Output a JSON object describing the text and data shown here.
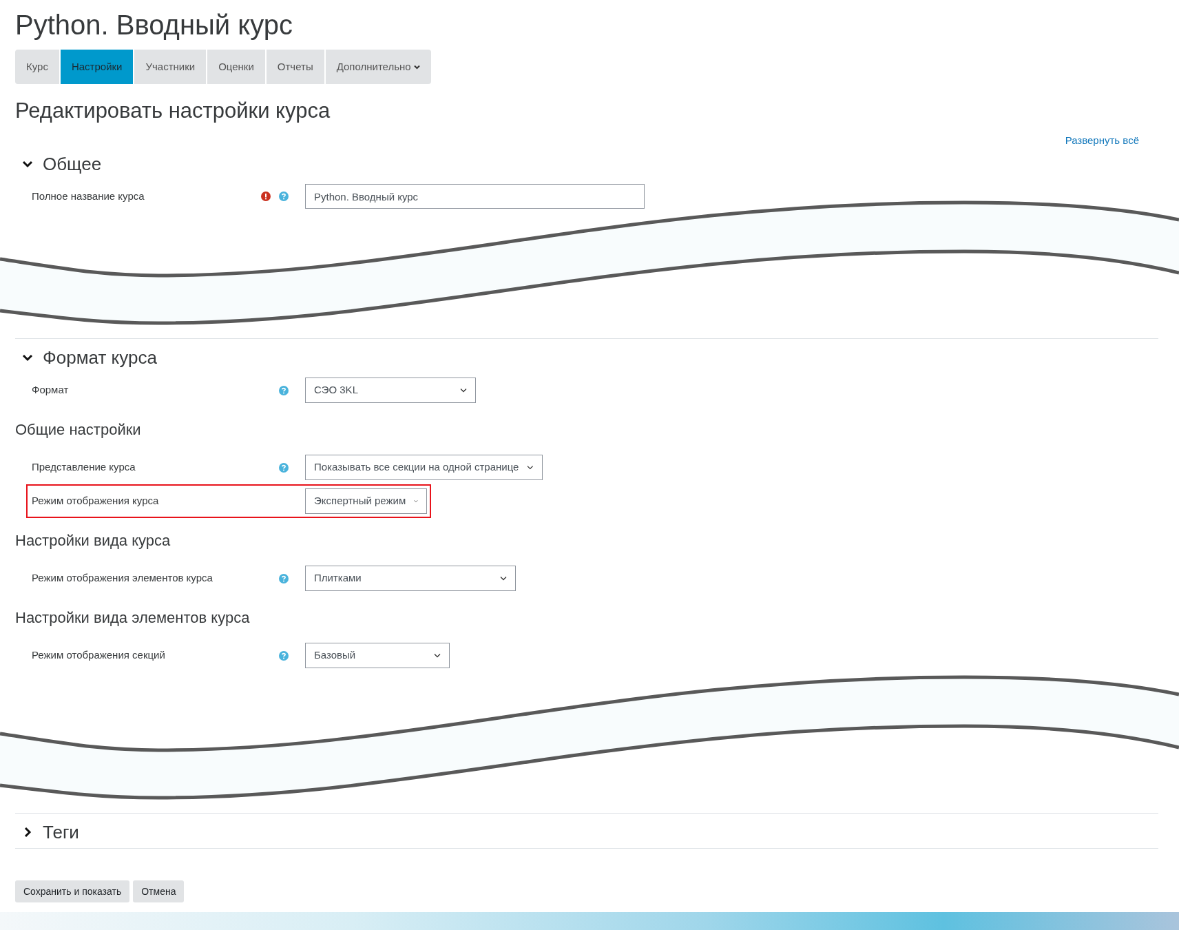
{
  "page_title": "Python. Вводный курс",
  "tabs": [
    {
      "label": "Курс",
      "selected": false,
      "dropdown": false
    },
    {
      "label": "Настройки",
      "selected": true,
      "dropdown": false
    },
    {
      "label": "Участники",
      "selected": false,
      "dropdown": false
    },
    {
      "label": "Оценки",
      "selected": false,
      "dropdown": false
    },
    {
      "label": "Отчеты",
      "selected": false,
      "dropdown": false
    },
    {
      "label": "Дополнительно",
      "selected": false,
      "dropdown": true
    }
  ],
  "heading": "Редактировать настройки курса",
  "expand_all": "Развернуть всё",
  "blocks": [
    {
      "kind": "section",
      "title": "Общее",
      "expanded": true,
      "rows": [
        {
          "kind": "text",
          "label": "Полное название курса",
          "required": true,
          "help": true,
          "value": "Python. Вводный курс",
          "highlighted": false
        }
      ]
    },
    {
      "kind": "cut"
    },
    {
      "kind": "section",
      "title": "Формат курса",
      "expanded": true,
      "rows": [
        {
          "kind": "select",
          "label": "Формат",
          "required": false,
          "help": true,
          "value": "СЭО 3KL",
          "highlighted": false
        },
        {
          "kind": "subheading",
          "label": "Общие настройки"
        },
        {
          "kind": "select",
          "label": "Представление курса",
          "required": false,
          "help": true,
          "value": "Показывать все секции на одной странице",
          "highlighted": false
        },
        {
          "kind": "select",
          "label": "Режим отображения курса",
          "required": false,
          "help": false,
          "value": "Экспертный режим",
          "highlighted": true
        },
        {
          "kind": "subheading",
          "label": "Настройки вида курса"
        },
        {
          "kind": "select",
          "label": "Режим отображения элементов курса",
          "required": false,
          "help": true,
          "value": "Плитками",
          "highlighted": false
        },
        {
          "kind": "subheading",
          "label": "Настройки вида элементов курса"
        },
        {
          "kind": "select",
          "label": "Режим отображения секций",
          "required": false,
          "help": true,
          "value": "Базовый",
          "highlighted": false
        }
      ]
    },
    {
      "kind": "cut"
    },
    {
      "kind": "section",
      "title": "Теги",
      "expanded": false
    }
  ],
  "buttons": [
    "Сохранить и показать",
    "Отмена"
  ]
}
